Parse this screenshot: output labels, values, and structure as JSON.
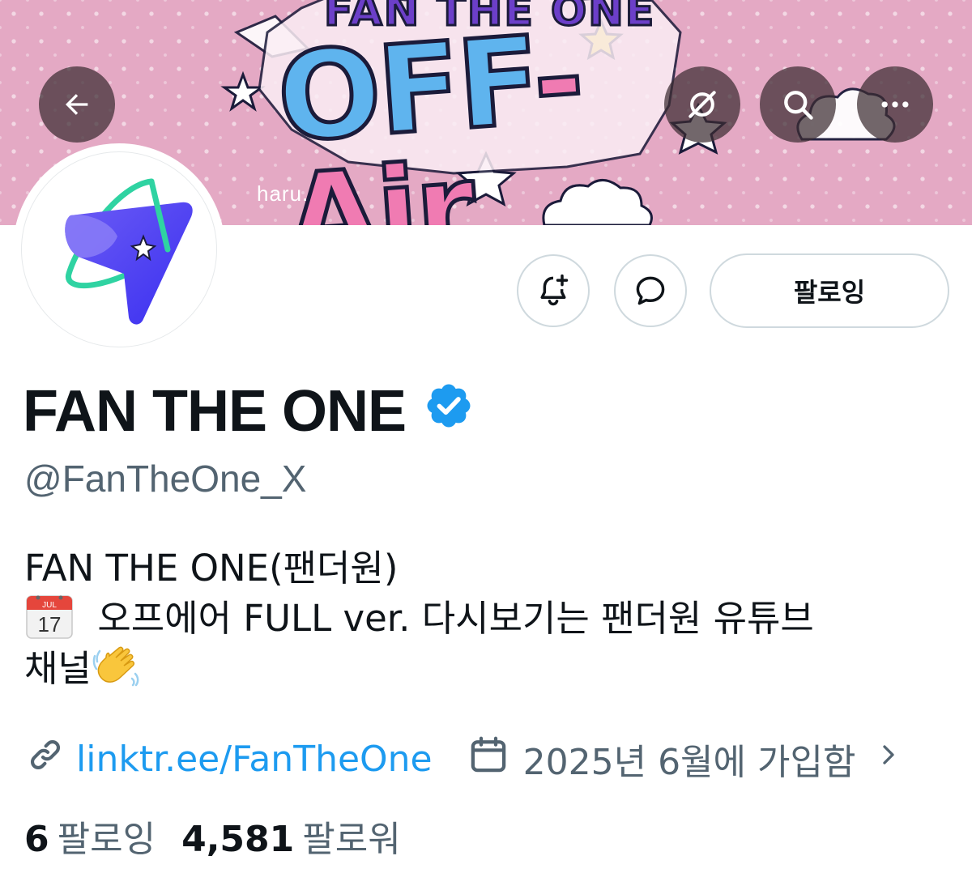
{
  "banner": {
    "logo_top": "FAN THE ONE",
    "logo_main_left": "OFF",
    "logo_main_right": "-Air",
    "credit": "haru."
  },
  "nav": {
    "back_icon": "arrow-left-icon",
    "icons": [
      "grok-icon",
      "search-icon",
      "more-icon"
    ]
  },
  "actions": {
    "notify_icon": "bell-plus-icon",
    "message_icon": "message-icon",
    "follow_label": "팔로잉"
  },
  "profile": {
    "display_name": "FAN THE ONE",
    "verified": true,
    "handle": "@FanTheOne_X",
    "bio_line1": "FAN THE ONE(팬더원)",
    "bio_line2": "오프에어 FULL ver. 다시보기는 팬더원 유튜브",
    "bio_line3": "채널",
    "calendar_emoji": {
      "month": "JUL",
      "day": "17"
    },
    "wave_emoji": "waving-hand",
    "link": "linktr.ee/FanTheOne",
    "joined": "2025년 6월에 가입함"
  },
  "stats": {
    "following_count": "6",
    "following_label": "팔로잉",
    "followers_count": "4,581",
    "followers_label": "팔로워"
  },
  "colors": {
    "banner_pink": "#e4a9c4",
    "link_blue": "#1d9bf0",
    "verified_blue": "#1d9bf0",
    "secondary_text": "#536471",
    "avatar_logo_blue": "#4b3ef0",
    "avatar_logo_green": "#2fd3a2"
  }
}
